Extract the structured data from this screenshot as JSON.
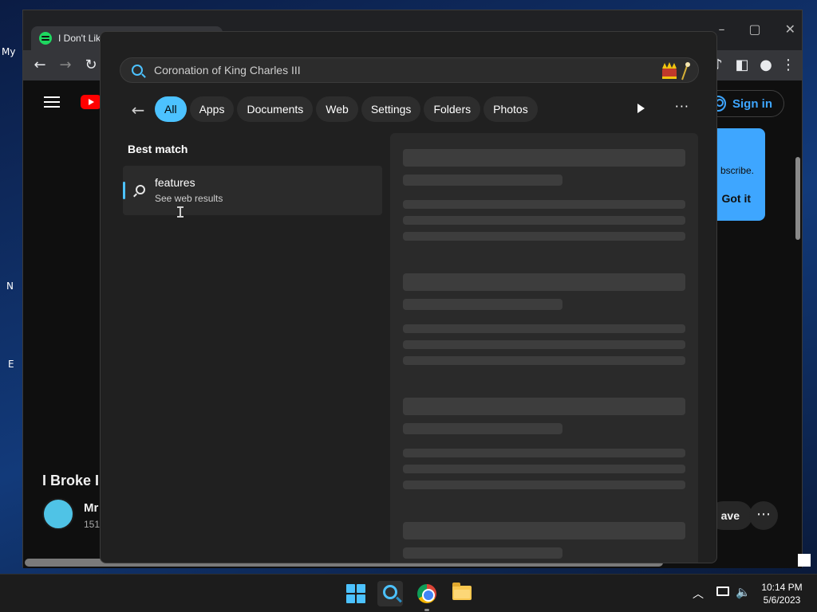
{
  "desktop": {
    "labels": [
      "My",
      "N",
      "E"
    ]
  },
  "browser": {
    "tab_title": "I Don't Lik",
    "youtube": {
      "sign_in": "Sign in",
      "tooltip_text": "bscribe.",
      "got_it": "Got it",
      "video_title": "I Broke I",
      "channel": "Mr",
      "subs": "151",
      "save": "ave",
      "more": "⋯"
    }
  },
  "search": {
    "query": "Coronation of King Charles III",
    "filters": [
      "All",
      "Apps",
      "Documents",
      "Web",
      "Settings",
      "Folders",
      "Photos"
    ],
    "active_filter": "All",
    "best_match_label": "Best match",
    "result": {
      "title": "features",
      "subtitle": "See web results"
    },
    "more": "···"
  },
  "taskbar": {
    "time": "10:14 PM",
    "date": "5/6/2023"
  },
  "colors": {
    "accent": "#4cc2ff",
    "panel": "#202020",
    "youtube_blue": "#3ea6ff"
  }
}
